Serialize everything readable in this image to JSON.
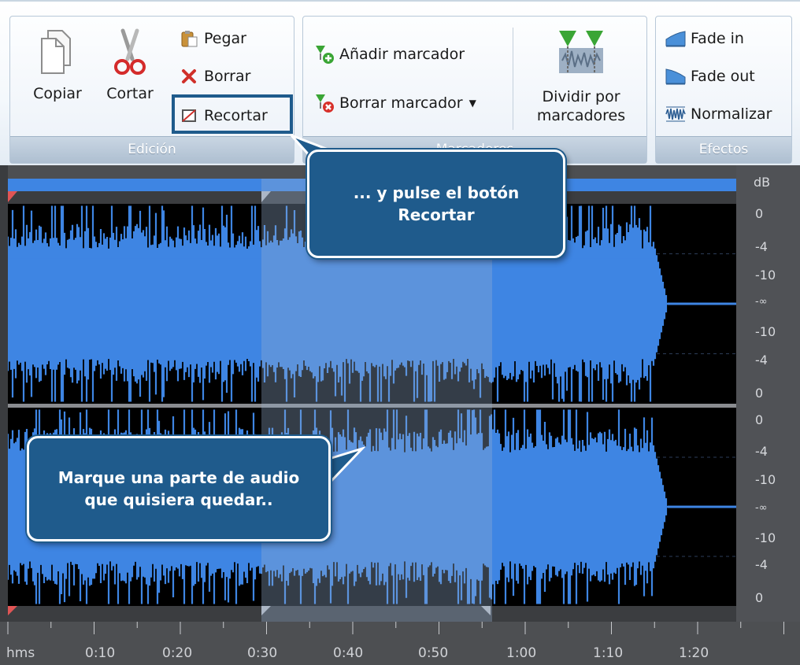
{
  "ribbon": {
    "edicion": {
      "group_label": "Edición",
      "copiar": "Copiar",
      "cortar": "Cortar",
      "pegar": "Pegar",
      "borrar": "Borrar",
      "recortar": "Recortar"
    },
    "marcadores": {
      "group_label": "Marcadores",
      "anadir": "Añadir marcador",
      "borrar_marcador": "Borrar marcador",
      "dividir_line1": "Dividir por",
      "dividir_line2": "marcadores"
    },
    "efectos": {
      "group_label": "Efectos",
      "fade_in": "Fade in",
      "fade_out": "Fade out",
      "normalizar": "Normalizar"
    }
  },
  "db_scale": {
    "unit": "dB",
    "track1": [
      "0",
      "-4",
      "-10",
      "-∞",
      "-10",
      "-4",
      "0"
    ],
    "track2": [
      "0",
      "-4",
      "-10",
      "-∞",
      "-10",
      "-4",
      "0"
    ]
  },
  "timeline": {
    "labels": [
      "hms",
      "0:10",
      "0:20",
      "0:30",
      "0:40",
      "0:50",
      "1:00",
      "1:10",
      "1:20"
    ]
  },
  "callouts": {
    "recortar_line1": "... y pulse el botón",
    "recortar_line2": "Recortar",
    "marque_line1": "Marque una parte de audio",
    "marque_line2": "que quisiera quedar.."
  },
  "colors": {
    "accent": "#1f5b8c",
    "waveform": "#3e85e3",
    "selection": "#96afcd"
  }
}
